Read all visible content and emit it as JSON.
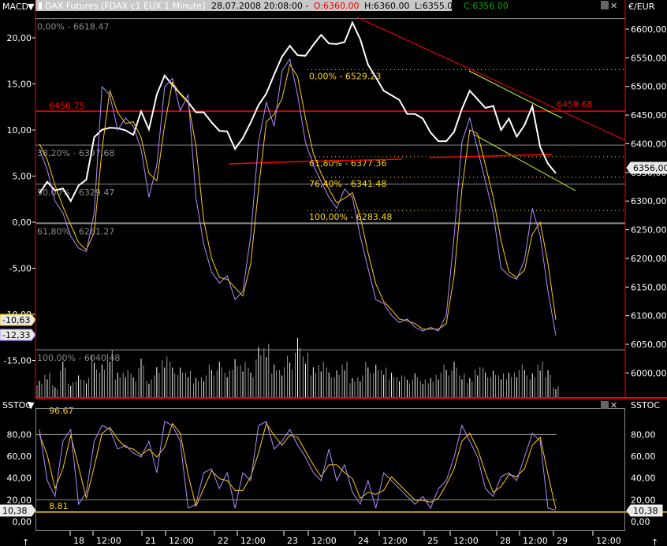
{
  "header": {
    "macd_label": "MACD",
    "title": "DAX Futures [FDAX c1 EUX  1 Minute]",
    "datetime": "28.07.2008 20:08:00 -",
    "open": "O:6360.00",
    "high": "H:6360.00",
    "low": "L:6355.00",
    "close": "C:6356.00",
    "currency": "€/EUR",
    "stoch_label_left": "SSTOC",
    "stoch_label_right": "SSTOC"
  },
  "colors": {
    "price": "#ffffff",
    "macd": "#b08cff",
    "signal": "#ffcc00",
    "fib_gray": "#8a8a8a",
    "fib_yellow": "#ffd700",
    "red": "#ff0000",
    "trend_green": "#ccff33",
    "volume": "#9a9a9a"
  },
  "chart_data": [
    {
      "type": "line",
      "title": "DAX Futures price",
      "ylabel": "€/EUR",
      "ylim": [
        5950,
        6625
      ],
      "y_ticks": [
        "6600,00",
        "6550,00",
        "6500,00",
        "6450,00",
        "6400,00",
        "6350,00",
        "6300,00",
        "6250,00",
        "6200,00",
        "6150,00",
        "6100,00",
        "6050,00",
        "6000,00"
      ],
      "y_tick_values": [
        6600,
        6550,
        6500,
        6450,
        6400,
        6350,
        6300,
        6250,
        6200,
        6150,
        6100,
        6050,
        6000
      ],
      "last_price_tag": "6356,00",
      "last_price": 6356,
      "price": [
        6321,
        6335,
        6314,
        6328,
        6300,
        6321,
        6342,
        6410,
        6417,
        6431,
        6424,
        6431,
        6417,
        6452,
        6431,
        6486,
        6513,
        6507,
        6486,
        6465,
        6458,
        6452,
        6445,
        6424,
        6417,
        6397,
        6410,
        6431,
        6472,
        6486,
        6513,
        6555,
        6568,
        6562,
        6555,
        6568,
        6596,
        6575,
        6568,
        6582,
        6610,
        6575,
        6541,
        6513,
        6500,
        6486,
        6472,
        6458,
        6452,
        6438,
        6424,
        6403,
        6397,
        6424,
        6458,
        6500,
        6479,
        6458,
        6472,
        6424,
        6438,
        6417,
        6431,
        6458,
        6397,
        6362,
        6356
      ],
      "volume": [
        30,
        45,
        20,
        60,
        25,
        40,
        35,
        70,
        55,
        80,
        45,
        50,
        40,
        65,
        30,
        55,
        75,
        60,
        50,
        45,
        35,
        40,
        55,
        60,
        45,
        70,
        65,
        50,
        85,
        90,
        60,
        55,
        70,
        100,
        75,
        55,
        65,
        50,
        45,
        60,
        35,
        40,
        60,
        55,
        50,
        45,
        40,
        35,
        40,
        30,
        35,
        45,
        55,
        60,
        40,
        35,
        55,
        50,
        45,
        40,
        45,
        50,
        55,
        40,
        60,
        50,
        20
      ],
      "fib_gray": [
        {
          "label": "0,00% - 6618.47",
          "price": 6618.47
        },
        {
          "label": "38,20% - 6397.68",
          "price": 6397.68
        },
        {
          "label": "50,00% - 6329.47",
          "price": 6329.47
        },
        {
          "label": "61,80% - 6261.27",
          "price": 6261.27
        },
        {
          "label": "100,00% - 6040.48",
          "price": 6040.48
        }
      ],
      "fib_yellow": [
        {
          "label": "0,00% - 6529.23",
          "price": 6529.23
        },
        {
          "label": "61,80% - 6377.36",
          "price": 6377.36
        },
        {
          "label": "76,40% - 6341.48",
          "price": 6341.48
        },
        {
          "label": "100,00% - 6283.48",
          "price": 6283.48
        }
      ],
      "resistance": [
        {
          "label": "6456.75",
          "price": 6456.75
        },
        {
          "label": "6459.68",
          "price": 6459.68
        }
      ]
    },
    {
      "type": "line",
      "title": "MACD",
      "ylim": [
        -20,
        22
      ],
      "y_ticks": [
        "20,00",
        "15,00",
        "10,00",
        "5,00",
        "0,00",
        "-5,00",
        "-10,00",
        "-15,00"
      ],
      "y_tick_values": [
        20,
        15,
        10,
        5,
        0,
        -5,
        -10,
        -15
      ],
      "signal_tag": "-10,63",
      "macd_tag": "-12,33",
      "series": [
        {
          "name": "MACD",
          "values": [
            7.9,
            5.7,
            2.3,
            1.0,
            -1.5,
            -2.8,
            -3.2,
            1.0,
            14.7,
            13.8,
            10.0,
            11.3,
            10.4,
            7.9,
            2.7,
            6.2,
            14.7,
            15.6,
            12.1,
            13.8,
            2.7,
            -2.4,
            -5.4,
            -6.6,
            -5.8,
            -8.4,
            -7.5,
            -1.5,
            8.7,
            13.0,
            10.4,
            16.4,
            17.7,
            13.8,
            8.7,
            6.2,
            4.4,
            2.7,
            1.5,
            3.6,
            2.7,
            -1.5,
            -5.0,
            -8.4,
            -8.8,
            -10.1,
            -10.9,
            -10.5,
            -11.4,
            -11.8,
            -11.4,
            -11.8,
            -10.1,
            -1.5,
            8.7,
            11.3,
            7.9,
            4.4,
            1.0,
            -5.0,
            -5.8,
            -6.2,
            -4.1,
            1.5,
            -1.5,
            -7.5,
            -12.3
          ]
        },
        {
          "name": "Signal",
          "values": [
            8.5,
            6.8,
            4.0,
            1.7,
            -0.3,
            -2.2,
            -3.0,
            -1.1,
            7.9,
            14.3,
            11.9,
            10.7,
            10.9,
            9.2,
            5.3,
            4.5,
            10.5,
            15.2,
            13.9,
            13.0,
            8.3,
            0.2,
            -3.9,
            -6.0,
            -6.2,
            -7.1,
            -8.0,
            -4.5,
            3.6,
            10.9,
            11.7,
            13.4,
            17.1,
            15.8,
            11.3,
            7.5,
            5.3,
            3.6,
            2.1,
            2.6,
            3.2,
            0.6,
            -3.3,
            -6.7,
            -8.6,
            -9.5,
            -10.5,
            -10.7,
            -11.0,
            -11.6,
            -11.6,
            -11.6,
            -11.0,
            -5.8,
            3.6,
            10.0,
            9.6,
            6.2,
            2.7,
            -2.0,
            -5.4,
            -6.0,
            -5.2,
            -1.3,
            0.0,
            -4.5,
            -10.6
          ]
        }
      ]
    },
    {
      "type": "line",
      "title": "SSTOC",
      "ylim": [
        -8,
        105
      ],
      "y_ticks": [
        "80,00",
        "60,00",
        "40,00",
        "20,00",
        "0,00"
      ],
      "y_tick_values": [
        80,
        60,
        40,
        20,
        0
      ],
      "level_high_label": "96.67",
      "level_low_label": "8.81",
      "level_low": 8.81,
      "last_tag": "10,38",
      "series": [
        {
          "name": "%K",
          "values": [
            84.6,
            37.6,
            23.1,
            73.8,
            84.6,
            15.9,
            26.8,
            73.8,
            88.2,
            84.6,
            66.5,
            70.1,
            62.9,
            59.3,
            73.8,
            44.8,
            91.8,
            88.2,
            73.8,
            12.3,
            15.9,
            44.8,
            48.4,
            30.4,
            44.8,
            12.3,
            44.8,
            37.6,
            88.2,
            91.8,
            66.5,
            73.8,
            84.6,
            70.1,
            59.3,
            44.8,
            37.6,
            66.5,
            37.6,
            52.1,
            26.8,
            15.9,
            37.6,
            12.3,
            44.8,
            37.6,
            30.4,
            23.1,
            15.9,
            23.1,
            12.3,
            30.4,
            37.6,
            59.3,
            88.2,
            73.8,
            59.3,
            30.4,
            23.1,
            41.2,
            44.8,
            37.6,
            59.3,
            81.0,
            73.8,
            12.3,
            10.4
          ]
        },
        {
          "name": "%D",
          "values": [
            80.0,
            61.1,
            30.4,
            48.5,
            79.2,
            50.3,
            21.4,
            50.3,
            81.0,
            86.4,
            75.6,
            68.3,
            66.5,
            61.1,
            66.5,
            59.3,
            68.3,
            90.0,
            81.0,
            43.1,
            14.1,
            30.4,
            46.6,
            39.4,
            37.6,
            28.6,
            28.6,
            41.2,
            62.9,
            90.0,
            79.2,
            70.1,
            79.2,
            77.4,
            64.7,
            52.1,
            41.2,
            52.1,
            52.1,
            44.9,
            39.5,
            21.4,
            26.8,
            25.0,
            28.6,
            41.2,
            34.0,
            26.8,
            19.5,
            19.5,
            17.7,
            21.4,
            34.0,
            48.5,
            73.8,
            81.0,
            66.5,
            44.9,
            26.8,
            32.2,
            43.0,
            41.2,
            48.5,
            70.1,
            77.4,
            43.1,
            11.4
          ]
        }
      ]
    }
  ],
  "x_axis": {
    "labels": [
      "18",
      "12:00",
      "21",
      "12:00",
      "22",
      "12:00",
      "23",
      "12:00",
      "24",
      "12:00",
      "25",
      "12:00",
      "28",
      "12:00",
      "29",
      "12:00"
    ]
  }
}
